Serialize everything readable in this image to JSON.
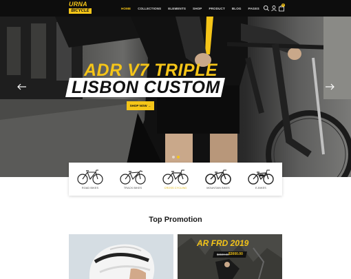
{
  "brand": {
    "logo_line1": "URNA",
    "logo_line2": "BICYCLE",
    "accent": "#f5c518"
  },
  "nav": {
    "items": [
      {
        "label": "HOME",
        "active": true
      },
      {
        "label": "COLLECTIONS"
      },
      {
        "label": "ELEMENTS"
      },
      {
        "label": "SHOP"
      },
      {
        "label": "PRODUCT"
      },
      {
        "label": "BLOG"
      },
      {
        "label": "PAGES"
      }
    ],
    "icons": [
      "search-icon",
      "user-icon",
      "cart-icon"
    ],
    "cart_count": "0"
  },
  "hero": {
    "title_line1": "ADR V7 TRIPLE",
    "title_line2": "LISBON CUSTOM",
    "button_label": "SHOP NOW →",
    "slide_count": 2,
    "active_slide": 2
  },
  "categories": [
    {
      "label": "ROAD BIKES"
    },
    {
      "label": "TRACK BIKES"
    },
    {
      "label": "CROSS CYCLING",
      "active": true
    },
    {
      "label": "MOUNTAIN BIKES"
    },
    {
      "label": "E-BIKES"
    }
  ],
  "promotion": {
    "title": "Top Promotion",
    "card_right": {
      "name": "AR FRD 2019",
      "old_price": "$3500.00",
      "new_price": "$3000.00"
    }
  }
}
